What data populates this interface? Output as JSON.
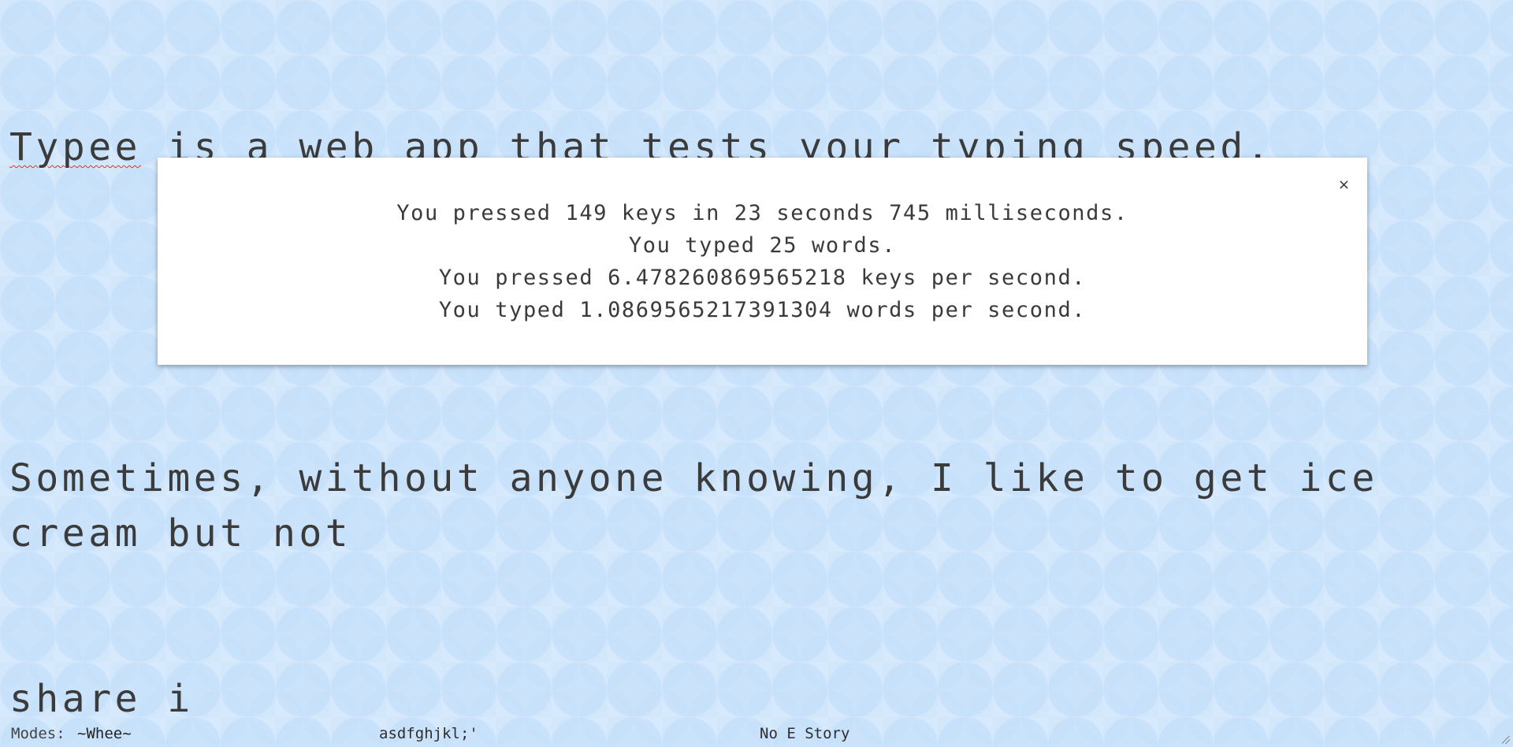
{
  "document": {
    "paragraph1": "Typee is a web app that tests your typing speed.",
    "paragraph1_first_word": "Typee",
    "paragraph1_rest": " is a web app that tests your typing speed.",
    "paragraph2_line1": "Sometimes, without anyone knowing, I like to get ice cream but not",
    "paragraph2_line2": "share i"
  },
  "results_modal": {
    "close_label": "×",
    "line1": "You pressed 149 keys in 23 seconds 745 milliseconds.",
    "line2": "You typed 25 words.",
    "line3": "You pressed 6.478260869565218 keys per second.",
    "line4": "You typed 1.0869565217391304 words per second."
  },
  "footer": {
    "modes_label": "Modes:",
    "modes_value": "~Whee~",
    "home_row": "asdfghjkl;'",
    "story_name": "No E Story"
  },
  "icons": {
    "close": "close-icon",
    "resize": "resize-grip-icon"
  },
  "colors": {
    "background": "#dcecfb",
    "modal_background": "#ffffff",
    "text": "#3b3b3b",
    "spellcheck_underline": "#e03030"
  }
}
